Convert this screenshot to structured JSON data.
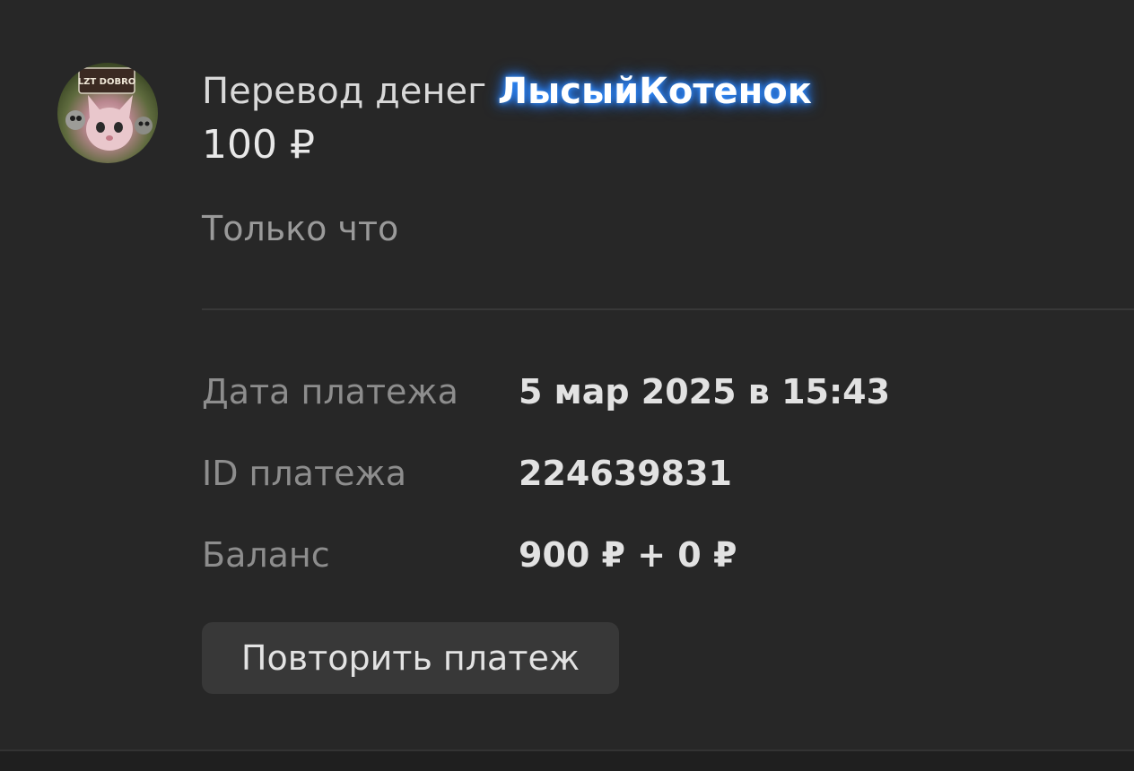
{
  "transaction": {
    "title_prefix": "Перевод денег",
    "username": "ЛысыйКотенок",
    "amount": "100 ₽",
    "time_label": "Только что",
    "avatar_text": "LZT DOBRO"
  },
  "details": {
    "date_label": "Дата платежа",
    "date_value": "5 мар 2025 в 15:43",
    "id_label": "ID платежа",
    "id_value": "224639831",
    "balance_label": "Баланс",
    "balance_value": "900 ₽ + 0 ₽"
  },
  "actions": {
    "repeat_label": "Повторить платеж"
  },
  "colors": {
    "background": "#272727",
    "username_glow": "#2f8cff",
    "button": "#383838"
  }
}
